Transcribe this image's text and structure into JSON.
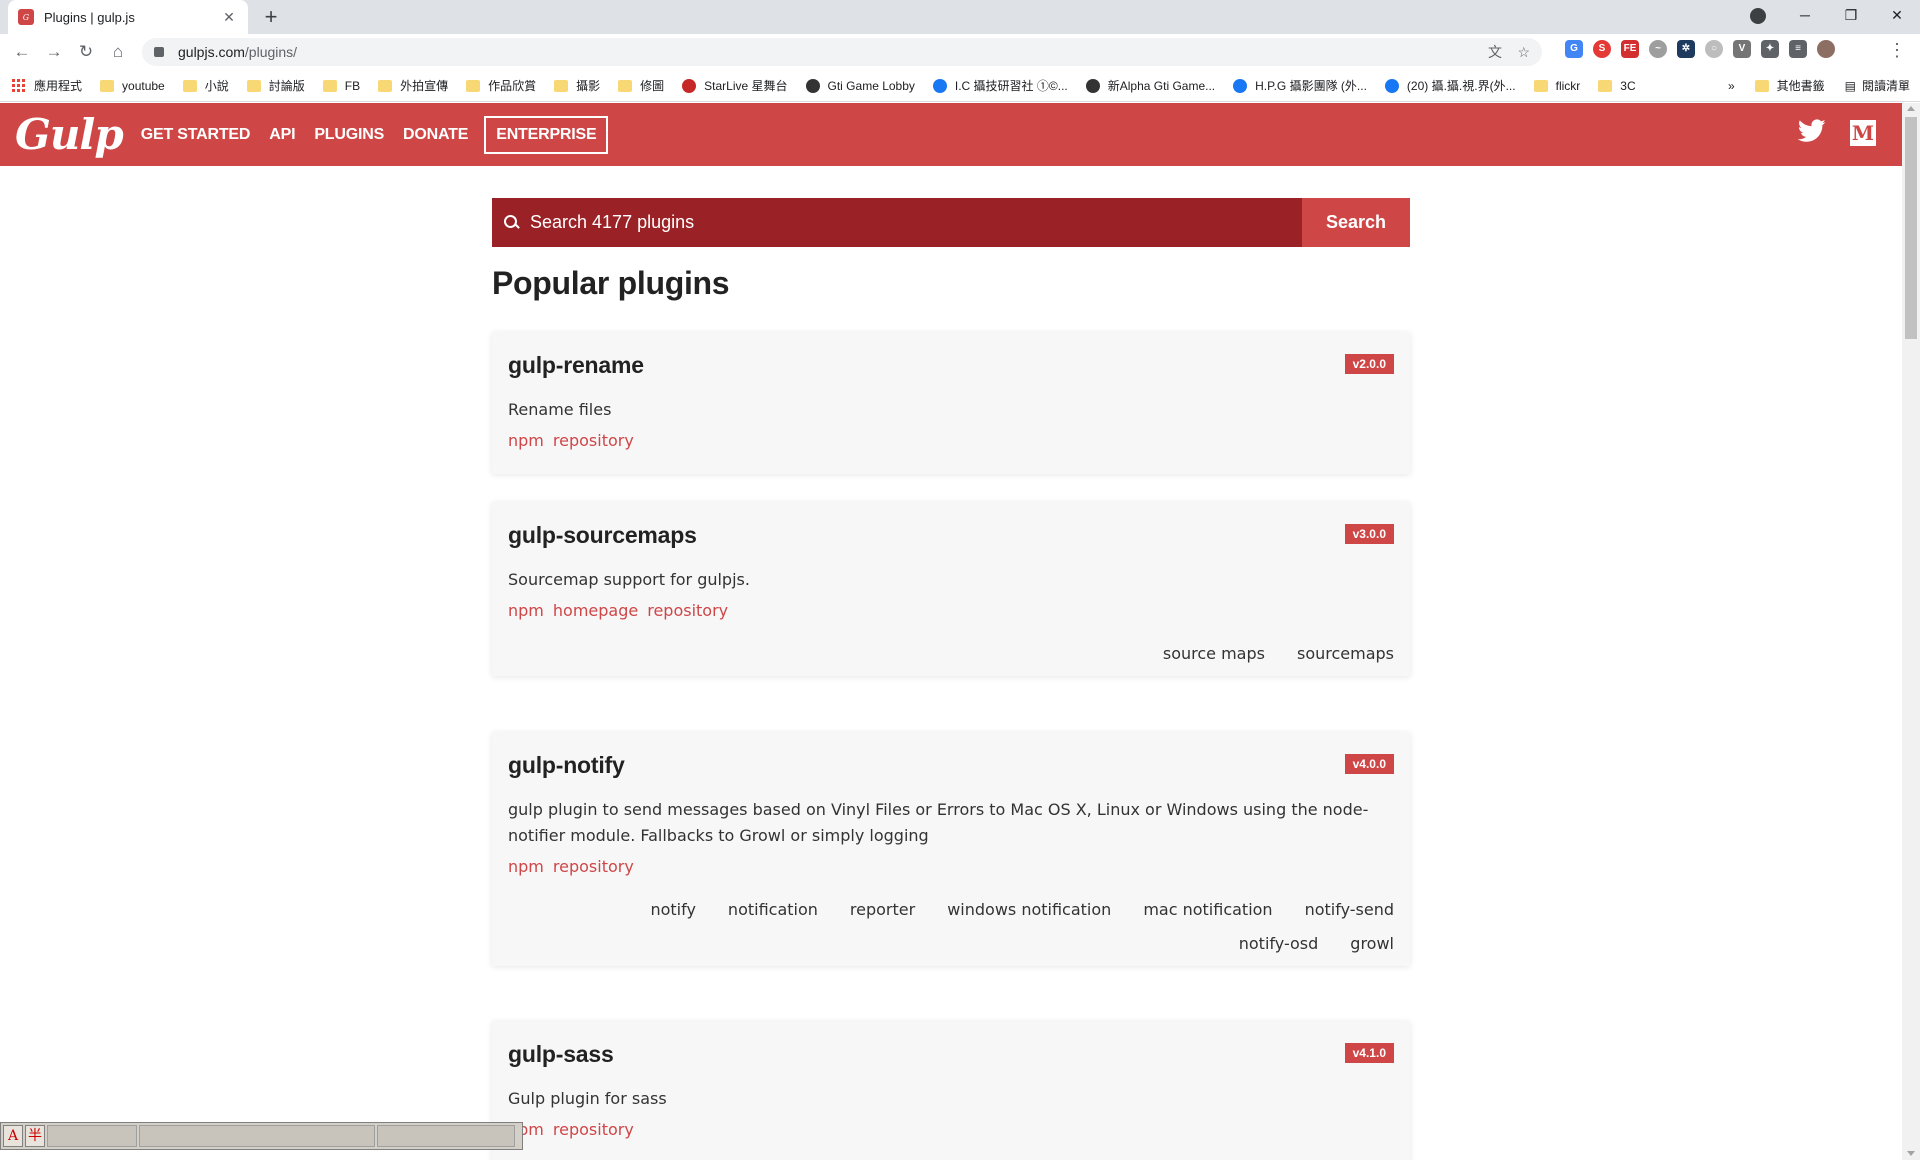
{
  "browser": {
    "tab_title": "Plugins | gulp.js",
    "tab_close": "✕",
    "new_tab": "+",
    "url_host": "gulpjs.com",
    "url_path": "/plugins/",
    "window": {
      "minimize": "─",
      "restore": "❐",
      "close": "✕"
    }
  },
  "bookmarks": [
    {
      "label": "應用程式",
      "kind": "apps"
    },
    {
      "label": "youtube",
      "kind": "folder"
    },
    {
      "label": "小說",
      "kind": "folder"
    },
    {
      "label": "討論版",
      "kind": "folder"
    },
    {
      "label": "FB",
      "kind": "folder"
    },
    {
      "label": "外拍宣傳",
      "kind": "folder"
    },
    {
      "label": "作品欣賞",
      "kind": "folder"
    },
    {
      "label": "攝影",
      "kind": "folder"
    },
    {
      "label": "修圖",
      "kind": "folder"
    },
    {
      "label": "StarLive 星舞台",
      "kind": "star"
    },
    {
      "label": "Gti Game Lobby",
      "kind": "dark"
    },
    {
      "label": "I.C 攝技研習社 ①©...",
      "kind": "round"
    },
    {
      "label": "新Alpha Gti Game...",
      "kind": "dark"
    },
    {
      "label": "H.P.G 攝影團隊 (外...",
      "kind": "round"
    },
    {
      "label": "(20) 攝.攝.視.界(外...",
      "kind": "round"
    },
    {
      "label": "flickr",
      "kind": "folder"
    },
    {
      "label": "3C",
      "kind": "folder"
    }
  ],
  "bookmarks_more": "»",
  "bookmarks_other": "其他書籤",
  "reading_list": "閱讀清單",
  "site": {
    "logo": "Gulp",
    "nav": [
      "GET STARTED",
      "API",
      "PLUGINS",
      "DONATE",
      "ENTERPRISE"
    ],
    "twitter_icon": "twitter-icon",
    "medium_label": "M"
  },
  "search": {
    "placeholder": "Search 4177 plugins",
    "button": "Search"
  },
  "heading": "Popular plugins",
  "plugins": [
    {
      "name": "gulp-rename",
      "version": "v2.0.0",
      "description": "Rename files",
      "links": [
        "npm",
        "repository"
      ],
      "tags": []
    },
    {
      "name": "gulp-sourcemaps",
      "version": "v3.0.0",
      "description": "Sourcemap support for gulpjs.",
      "links": [
        "npm",
        "homepage",
        "repository"
      ],
      "tags": [
        "source maps",
        "sourcemaps"
      ]
    },
    {
      "name": "gulp-notify",
      "version": "v4.0.0",
      "description": "gulp plugin to send messages based on Vinyl Files or Errors to Mac OS X, Linux or Windows using the node-notifier module. Fallbacks to Growl or simply logging",
      "links": [
        "npm",
        "repository"
      ],
      "tags": [
        "notify",
        "notification",
        "reporter",
        "windows notification",
        "mac notification",
        "notify-send",
        "notify-osd",
        "growl"
      ]
    },
    {
      "name": "gulp-sass",
      "version": "v4.1.0",
      "description": "Gulp plugin for sass",
      "links": [
        "npm",
        "repository"
      ],
      "tags": []
    }
  ],
  "ime": {
    "mode": "A",
    "width": "半"
  }
}
